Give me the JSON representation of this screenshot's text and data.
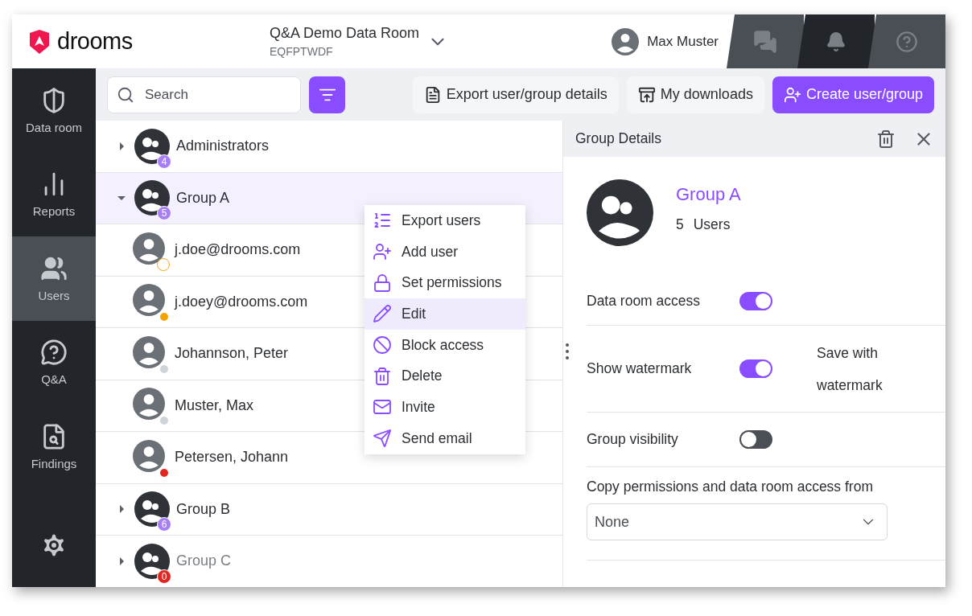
{
  "header": {
    "logo": "drooms",
    "room": {
      "name": "Q&A Demo Data Room",
      "code": "EQFPTWDF"
    },
    "user": "Max Muster",
    "tabs": [
      {
        "kind": "chat",
        "selected": false
      },
      {
        "kind": "bell",
        "selected": true
      },
      {
        "kind": "help",
        "selected": false
      }
    ]
  },
  "sidebar": {
    "items": [
      {
        "kind": "dataroom",
        "label": "Data room",
        "selected": false
      },
      {
        "kind": "reports",
        "label": "Reports",
        "selected": false
      },
      {
        "kind": "users",
        "label": "Users",
        "selected": true
      },
      {
        "kind": "qa",
        "label": "Q&A",
        "selected": false
      },
      {
        "kind": "findings",
        "label": "Findings",
        "selected": false
      }
    ]
  },
  "toolbar": {
    "search": {
      "placeholder": "Search"
    },
    "buttons": [
      {
        "kind": "export",
        "label": "Export user/group details"
      },
      {
        "kind": "downloads",
        "label": "My downloads"
      },
      {
        "kind": "create",
        "label": "Create user/group"
      }
    ]
  },
  "tree": [
    {
      "name": "Administrators",
      "count": "4",
      "color": "#a77ef5",
      "expanded": false,
      "selected": false,
      "disabled": false
    },
    {
      "name": "Group A",
      "count": "5",
      "color": "#a77ef5",
      "expanded": true,
      "selected": true,
      "disabled": false,
      "children": [
        {
          "name": "j.doe@drooms.com",
          "color": "#f5a623",
          "kind": "ring"
        },
        {
          "name": "j.doey@drooms.com",
          "color": "#f5a300",
          "kind": "dot"
        },
        {
          "name": "Johannson, Peter",
          "color": "#d0d3d8",
          "kind": "dot"
        },
        {
          "name": "Muster, Max",
          "color": "#d0d3d8",
          "kind": "dot"
        },
        {
          "name": "Petersen, Johann",
          "color": "#e0261f",
          "kind": "dot"
        }
      ]
    },
    {
      "name": "Group B",
      "count": "6",
      "color": "#a77ef5",
      "expanded": false,
      "selected": false,
      "disabled": false
    },
    {
      "name": "Group C",
      "count": "0",
      "color": "#e0261f",
      "expanded": false,
      "selected": false,
      "disabled": true
    }
  ],
  "context_menu": [
    {
      "kind": "export",
      "label": "Export users",
      "selected": false
    },
    {
      "kind": "adduser",
      "label": "Add user",
      "selected": false
    },
    {
      "kind": "lock",
      "label": "Set permissions",
      "selected": false
    },
    {
      "kind": "edit",
      "label": "Edit",
      "selected": true
    },
    {
      "kind": "block",
      "label": "Block access",
      "selected": false
    },
    {
      "kind": "delete",
      "label": "Delete",
      "selected": false
    },
    {
      "kind": "invite",
      "label": "Invite",
      "selected": false
    },
    {
      "kind": "send",
      "label": "Send email",
      "selected": false
    }
  ],
  "details": {
    "title": "Group Details",
    "group_name": "Group A",
    "user_count": "5",
    "user_label": "Users",
    "settings": [
      {
        "label": "Data room access",
        "on": true
      },
      {
        "label": "Show watermark",
        "on": true,
        "note": "Save with watermark"
      },
      {
        "label": "Group visibility",
        "on": false
      }
    ],
    "copy_from": {
      "label": "Copy permissions and data room access from",
      "value": "None"
    }
  }
}
